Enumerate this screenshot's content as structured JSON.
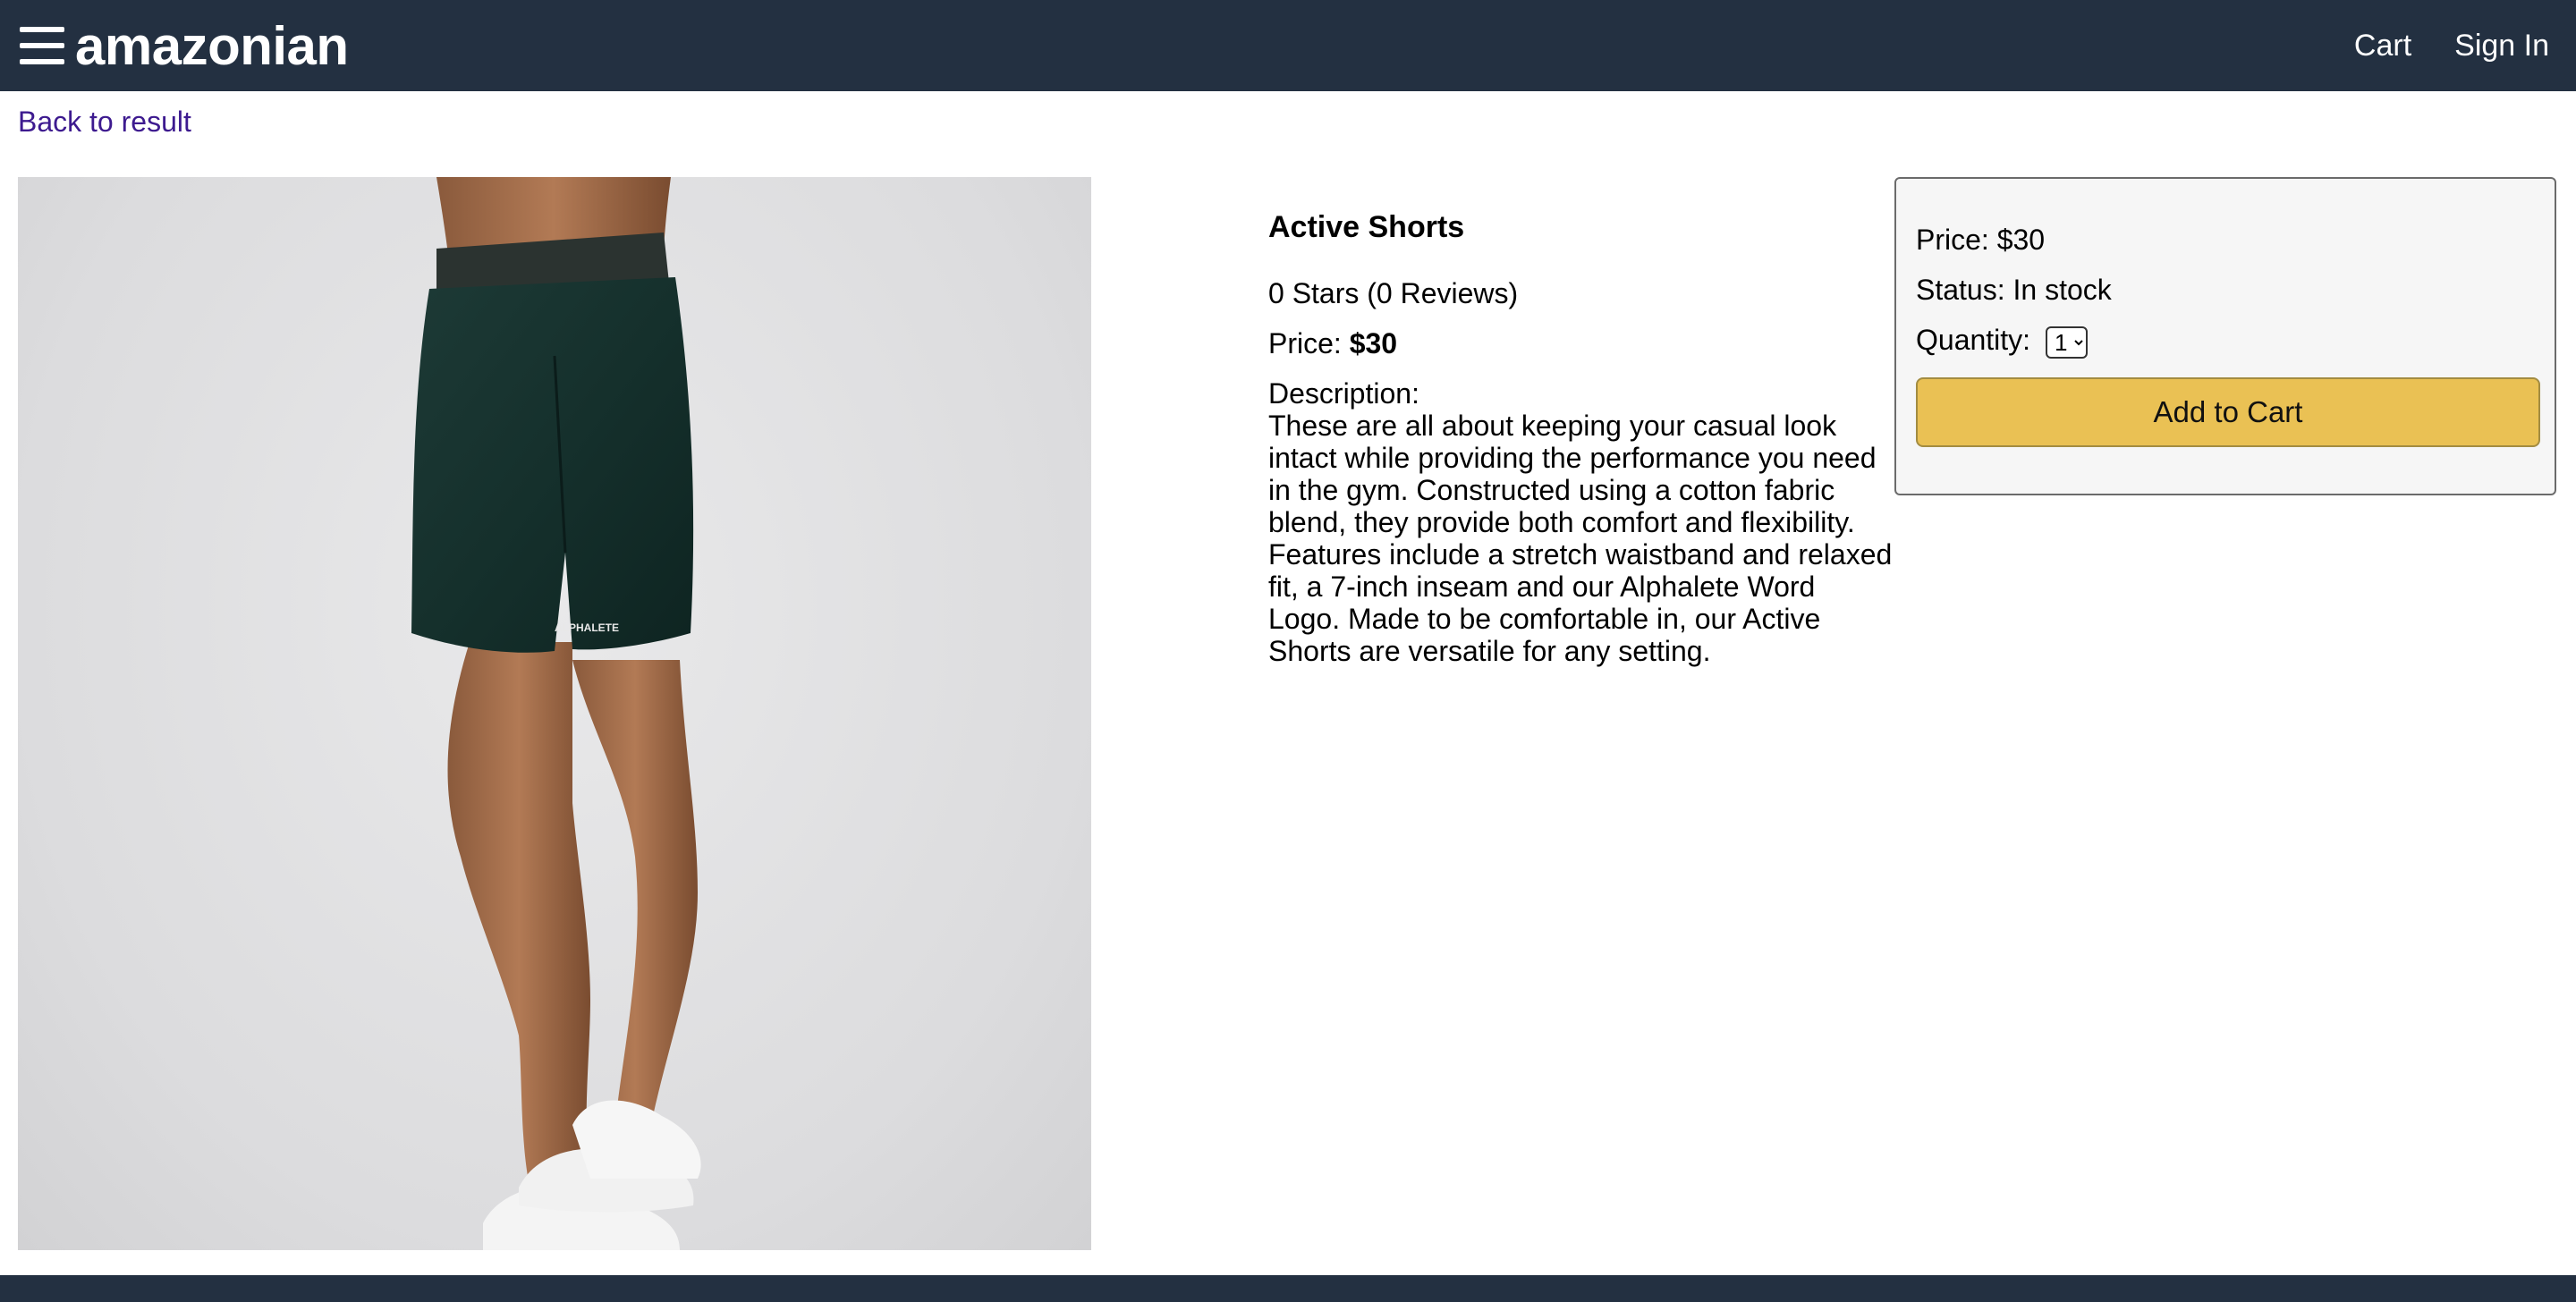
{
  "header": {
    "logo": "amazonian",
    "menu_icon": "hamburger-menu-icon",
    "links": {
      "cart": "Cart",
      "sign_in": "Sign In"
    }
  },
  "back_link": "Back to result",
  "product": {
    "title": "Active Shorts",
    "rating": "0 Stars (0 Reviews)",
    "price_label": "Price:",
    "price_value": "$30",
    "description_label": "Description:",
    "description": "These are all about keeping your casual look intact while providing the performance you need in the gym. Constructed using a cotton fabric blend, they provide both comfort and flexibility. Features include a stretch waistband and relaxed fit, a 7-inch inseam and our Alphalete Word Logo. Made to be comfortable in, our Active Shorts are versatile for any setting.",
    "image_logo_text": "ALPHALETE"
  },
  "buybox": {
    "price": "Price: $30",
    "status": "Status: In stock",
    "quantity_label": "Quantity:",
    "quantity_selected": "1",
    "add_to_cart": "Add to Cart"
  },
  "colors": {
    "nav_bg": "#233041",
    "button_bg": "#eac154",
    "link": "#3d1a8f"
  }
}
